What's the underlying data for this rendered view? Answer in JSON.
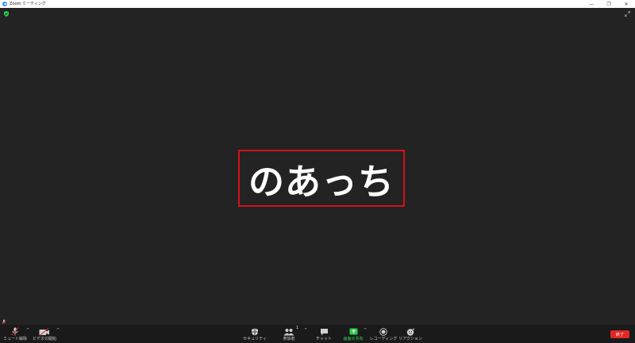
{
  "window": {
    "title": "Zoom ミーティング",
    "minimize_glyph": "—",
    "maximize_glyph": "❐",
    "close_glyph": "✕"
  },
  "stage": {
    "participant_name": "のあっち",
    "highlight_color": "#d6101a"
  },
  "toolbar": {
    "unmute_label": "ミュート解除",
    "start_video_label": "ビデオの開始",
    "security_label": "セキュリティ",
    "participants_label": "参加者",
    "participants_count": "1",
    "chat_label": "チャット",
    "share_screen_label": "画面の共有",
    "record_label": "レコーディング",
    "reactions_label": "リアクション",
    "end_label": "終了",
    "caret_glyph": "^"
  },
  "colors": {
    "background": "#232323",
    "toolbar": "#1a1a1a",
    "share_green": "#2dcc4f",
    "end_red": "#e02828",
    "mute_red": "#e02828"
  }
}
